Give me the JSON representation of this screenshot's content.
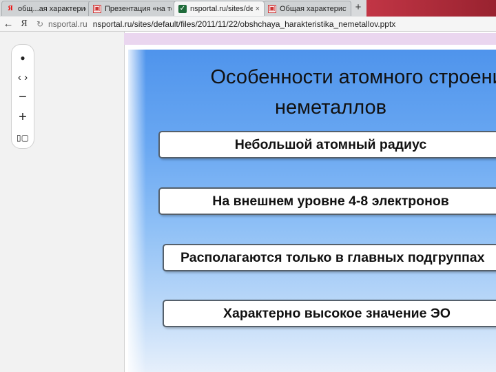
{
  "browser": {
    "tabs": [
      {
        "label": "общ...ая характеристи",
        "icon": "yandex-icon",
        "close": "×"
      },
      {
        "label": "Презентация «на тему",
        "icon": "slides-icon",
        "close": "×"
      },
      {
        "label": "nsportal.ru/sites/defa...",
        "icon": "nsportal-icon",
        "close": "×"
      },
      {
        "label": "Общая характеристи",
        "icon": "slides-icon",
        "close": "×"
      }
    ],
    "new_tab": "+",
    "back": "←",
    "yandex": "Я",
    "reload": "↻",
    "host": "nsportal.ru",
    "url": "nsportal.ru/sites/default/files/2011/11/22/obshchaya_harakteristika_nemetallov.pptx"
  },
  "toolbar": {
    "items": [
      {
        "icon": "dot-icon",
        "glyph": "●"
      },
      {
        "icon": "arrows-icon",
        "glyph": "‹ ›"
      },
      {
        "icon": "zoom-out-icon",
        "glyph": "−"
      },
      {
        "icon": "zoom-in-icon",
        "glyph": "+"
      },
      {
        "icon": "slides-view-icon",
        "glyph": "▯▢"
      }
    ]
  },
  "slide": {
    "title_line1": "Особенности атомного строения",
    "title_line2": "неметаллов",
    "boxes": [
      "Небольшой атомный радиус",
      "На внешнем уровне 4-8 электронов",
      "Располагаются только в главных подгруппах",
      "Характерно высокое значение ЭО"
    ]
  },
  "colors": {
    "slide_top": "#4f94ec",
    "slide_bottom": "#e7f0fb",
    "top_strip": "#ead6ef"
  }
}
